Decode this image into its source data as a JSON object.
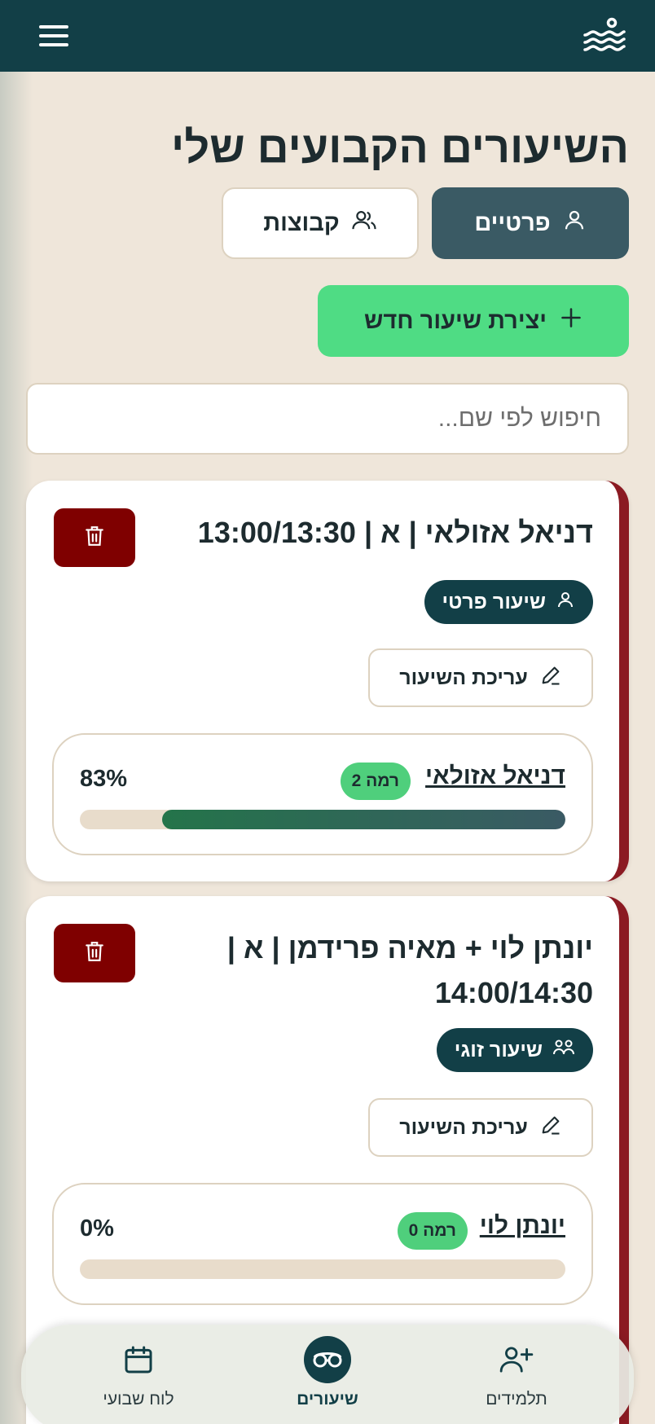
{
  "header": {
    "menu_icon": "hamburger-menu-icon",
    "logo_icon": "swimmer-waves-icon"
  },
  "page": {
    "title": "השיעורים הקבועים שלי"
  },
  "tabs": [
    {
      "label": "פרטיים",
      "icon": "user-icon",
      "active": true
    },
    {
      "label": "קבוצות",
      "icon": "users-icon",
      "active": false
    }
  ],
  "create_button": {
    "label": "יצירת שיעור חדש",
    "icon": "plus-icon"
  },
  "search": {
    "placeholder": "חיפוש לפי שם..."
  },
  "lessons": [
    {
      "title": "דניאל אזולאי | א | 13:00/13:30",
      "badge": "שיעור פרטי",
      "badge_icon": "user-icon",
      "edit_label": "עריכת השיעור",
      "students": [
        {
          "name": "דניאל אזולאי",
          "level": "רמה 2",
          "percent_label": "83%",
          "progress": 83
        }
      ]
    },
    {
      "title": "יונתן לוי + מאיה פרידמן | א | 14:00/14:30",
      "badge": "שיעור זוגי",
      "badge_icon": "pair-icon",
      "edit_label": "עריכת השיעור",
      "students": [
        {
          "name": "יונתן לוי",
          "level": "רמה 0",
          "percent_label": "0%",
          "progress": 0
        }
      ]
    }
  ],
  "colors": {
    "header": "#123f47",
    "accent_green": "#4fdc84",
    "delete_red": "#7f0000",
    "card_border": "#8b1a22",
    "background": "#efe6da"
  },
  "bottom_nav": [
    {
      "label": "תלמידים",
      "icon": "user-plus-icon"
    },
    {
      "label": "שיעורים",
      "icon": "goggles-icon",
      "active": true
    },
    {
      "label": "לוח שבועי",
      "icon": "calendar-icon"
    }
  ]
}
